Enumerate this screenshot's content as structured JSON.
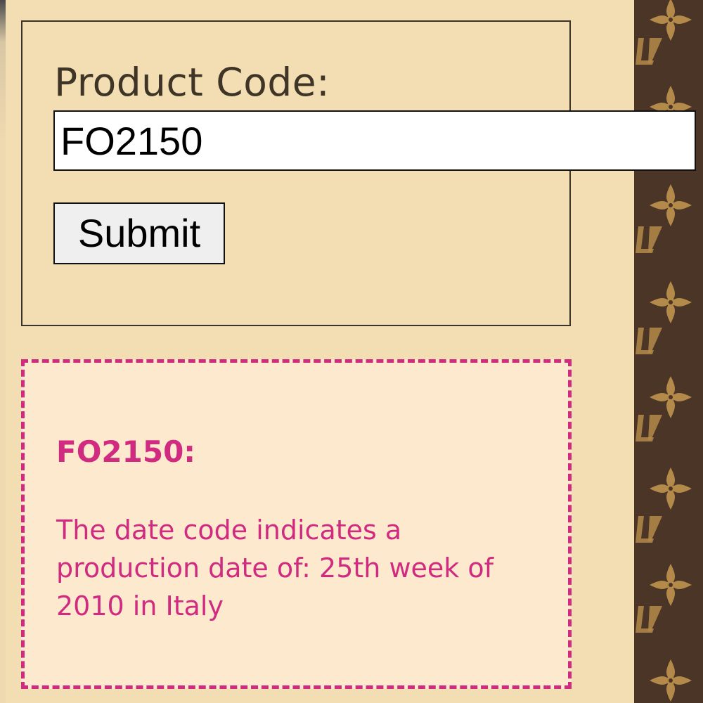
{
  "form": {
    "label": "Product Code:",
    "input_value": "FO2150",
    "submit_label": "Submit"
  },
  "result": {
    "code_heading": "FO2150:",
    "message": "The date code indicates a production date of: 25th week of 2010 in Italy"
  },
  "colors": {
    "background": "#f3ddb3",
    "accent": "#d02b80",
    "pattern_brown": "#4a3526",
    "pattern_gold": "#b48a4a"
  },
  "icons": [
    "quatrefoil-flower-icon",
    "lv-monogram-icon"
  ]
}
